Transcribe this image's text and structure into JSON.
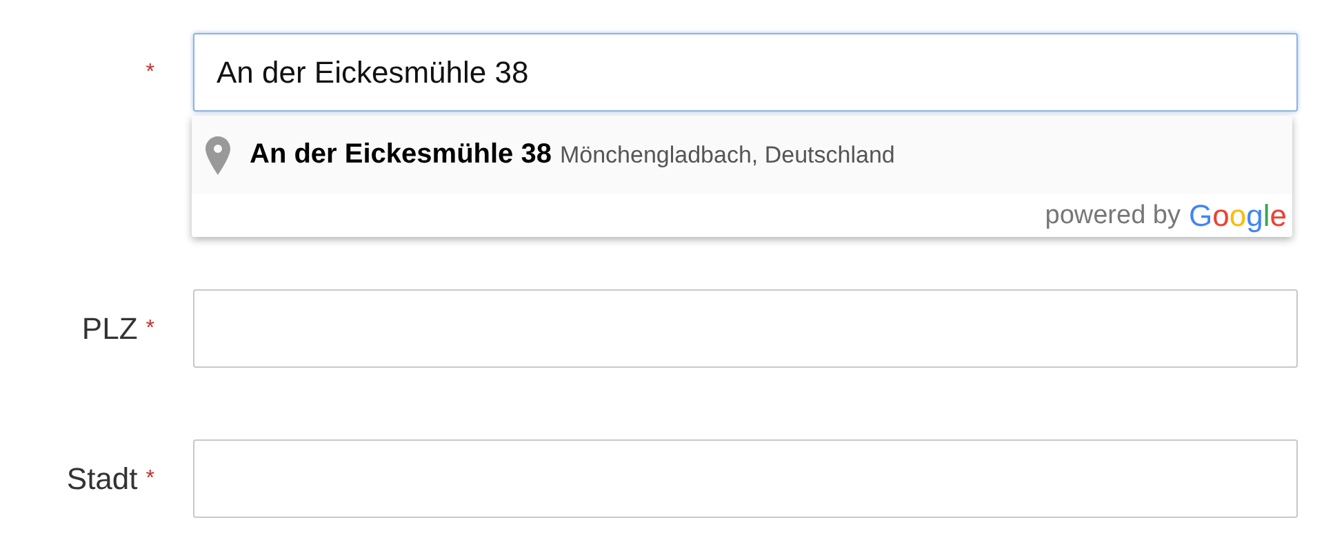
{
  "fields": [
    {
      "required_mark": "*",
      "value": "An der Eickesmühle 38",
      "focused": true
    },
    {
      "label": "PLZ",
      "required_mark": "*",
      "focused": false
    },
    {
      "label": "Stadt",
      "required_mark": "*",
      "focused": false
    }
  ],
  "autocomplete": {
    "suggestions": [
      {
        "main": "An der Eickesmühle 38",
        "secondary": "Mönchengladbach, Deutschland"
      }
    ],
    "attribution": "powered by",
    "brand": "Google"
  }
}
